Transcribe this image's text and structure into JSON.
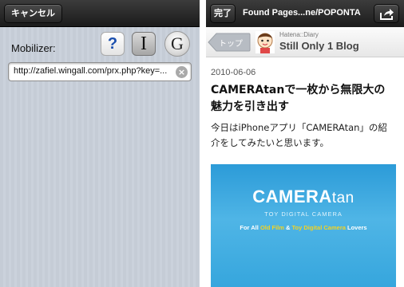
{
  "left": {
    "cancel_label": "キャンセル",
    "mobilizer_label": "Mobilizer:",
    "mobilizer_options": [
      {
        "name": "help",
        "glyph": "?"
      },
      {
        "name": "instapaper",
        "glyph": "I"
      },
      {
        "name": "google",
        "glyph": "G"
      }
    ],
    "url_value": "http://zafiel.wingall.com/prx.php?key=..."
  },
  "right": {
    "done_label": "完了",
    "title": "Found Pages...ne/POPONTA",
    "back_label": "トップ",
    "blog_service": "Hatena::Diary",
    "blog_name": "Still Only 1 Blog",
    "post": {
      "date": "2010-06-06",
      "title": "CAMERAtanで一枚から無限大の魅力を引き出す",
      "body": "今日はiPhoneアプリ「CAMERAtan」の紹介をしてみたいと思います。"
    },
    "hero": {
      "title_bold": "CAMERA",
      "title_thin": "tan",
      "subtitle": "TOY DIGITAL CAMERA",
      "tag_1": "For All ",
      "tag_2": "Old Film",
      "tag_3": " & ",
      "tag_4": "Toy Digital Camera",
      "tag_5": " Lovers"
    }
  },
  "icons": {
    "clear": "clear-icon",
    "share": "share-icon",
    "back": "back-arrow-icon"
  },
  "colors": {
    "toolbar": "#262626",
    "hero_blue": "#3aa9e0",
    "hero_highlight": "#f5d320"
  }
}
